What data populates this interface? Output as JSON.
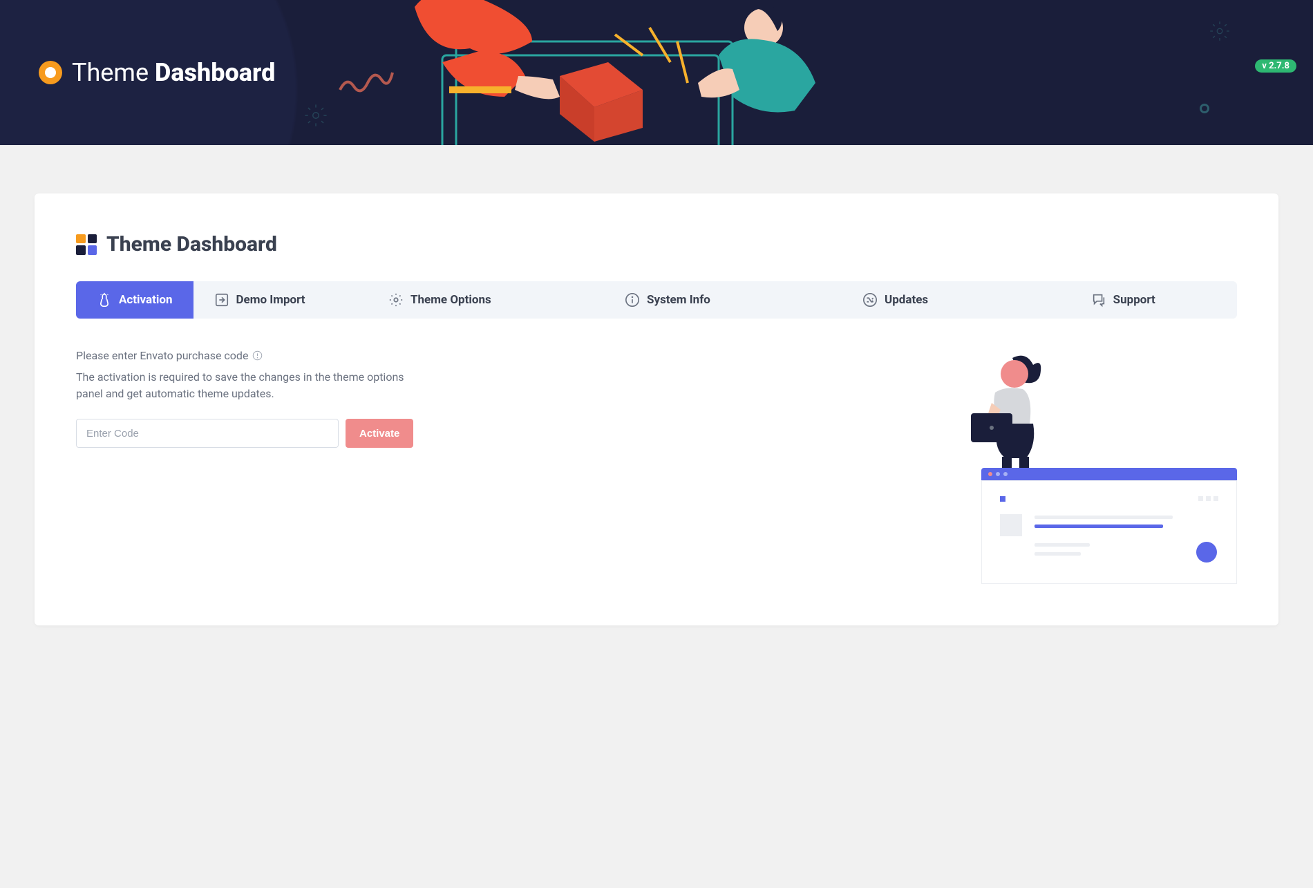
{
  "hero": {
    "title_light": "Theme",
    "title_bold": "Dashboard",
    "version": "v 2.7.8"
  },
  "card": {
    "title": "Theme Dashboard"
  },
  "tabs": [
    {
      "label": "Activation",
      "icon": "tap-icon",
      "active": true
    },
    {
      "label": "Demo Import",
      "icon": "import-icon",
      "active": false
    },
    {
      "label": "Theme Options",
      "icon": "gear-icon",
      "active": false
    },
    {
      "label": "System Info",
      "icon": "info-icon",
      "active": false
    },
    {
      "label": "Updates",
      "icon": "shuffle-icon",
      "active": false
    },
    {
      "label": "Support",
      "icon": "chat-icon",
      "active": false
    }
  ],
  "activation": {
    "prompt": "Please enter Envato purchase code",
    "description": "The activation is required to save the changes in the theme options panel and get automatic theme updates.",
    "placeholder": "Enter Code",
    "button": "Activate"
  }
}
